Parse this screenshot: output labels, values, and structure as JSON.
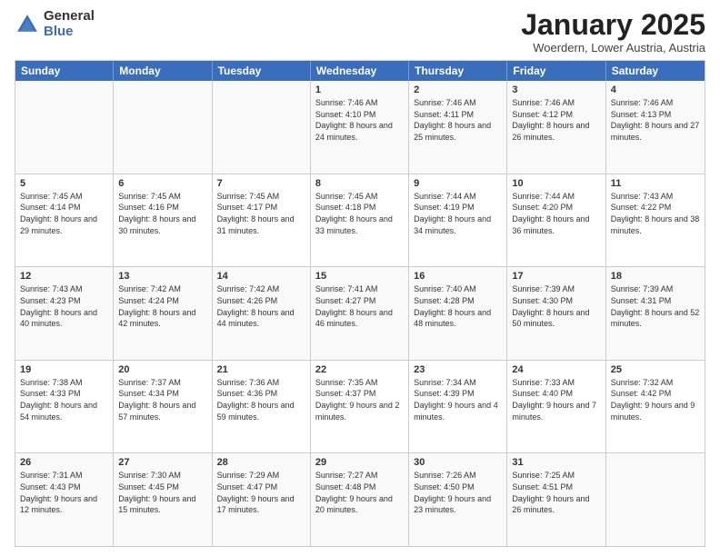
{
  "logo": {
    "general": "General",
    "blue": "Blue"
  },
  "title": "January 2025",
  "subtitle": "Woerdern, Lower Austria, Austria",
  "days_of_week": [
    "Sunday",
    "Monday",
    "Tuesday",
    "Wednesday",
    "Thursday",
    "Friday",
    "Saturday"
  ],
  "weeks": [
    [
      {
        "day": "",
        "sunrise": "",
        "sunset": "",
        "daylight": ""
      },
      {
        "day": "",
        "sunrise": "",
        "sunset": "",
        "daylight": ""
      },
      {
        "day": "",
        "sunrise": "",
        "sunset": "",
        "daylight": ""
      },
      {
        "day": "1",
        "sunrise": "Sunrise: 7:46 AM",
        "sunset": "Sunset: 4:10 PM",
        "daylight": "Daylight: 8 hours and 24 minutes."
      },
      {
        "day": "2",
        "sunrise": "Sunrise: 7:46 AM",
        "sunset": "Sunset: 4:11 PM",
        "daylight": "Daylight: 8 hours and 25 minutes."
      },
      {
        "day": "3",
        "sunrise": "Sunrise: 7:46 AM",
        "sunset": "Sunset: 4:12 PM",
        "daylight": "Daylight: 8 hours and 26 minutes."
      },
      {
        "day": "4",
        "sunrise": "Sunrise: 7:46 AM",
        "sunset": "Sunset: 4:13 PM",
        "daylight": "Daylight: 8 hours and 27 minutes."
      }
    ],
    [
      {
        "day": "5",
        "sunrise": "Sunrise: 7:45 AM",
        "sunset": "Sunset: 4:14 PM",
        "daylight": "Daylight: 8 hours and 29 minutes."
      },
      {
        "day": "6",
        "sunrise": "Sunrise: 7:45 AM",
        "sunset": "Sunset: 4:16 PM",
        "daylight": "Daylight: 8 hours and 30 minutes."
      },
      {
        "day": "7",
        "sunrise": "Sunrise: 7:45 AM",
        "sunset": "Sunset: 4:17 PM",
        "daylight": "Daylight: 8 hours and 31 minutes."
      },
      {
        "day": "8",
        "sunrise": "Sunrise: 7:45 AM",
        "sunset": "Sunset: 4:18 PM",
        "daylight": "Daylight: 8 hours and 33 minutes."
      },
      {
        "day": "9",
        "sunrise": "Sunrise: 7:44 AM",
        "sunset": "Sunset: 4:19 PM",
        "daylight": "Daylight: 8 hours and 34 minutes."
      },
      {
        "day": "10",
        "sunrise": "Sunrise: 7:44 AM",
        "sunset": "Sunset: 4:20 PM",
        "daylight": "Daylight: 8 hours and 36 minutes."
      },
      {
        "day": "11",
        "sunrise": "Sunrise: 7:43 AM",
        "sunset": "Sunset: 4:22 PM",
        "daylight": "Daylight: 8 hours and 38 minutes."
      }
    ],
    [
      {
        "day": "12",
        "sunrise": "Sunrise: 7:43 AM",
        "sunset": "Sunset: 4:23 PM",
        "daylight": "Daylight: 8 hours and 40 minutes."
      },
      {
        "day": "13",
        "sunrise": "Sunrise: 7:42 AM",
        "sunset": "Sunset: 4:24 PM",
        "daylight": "Daylight: 8 hours and 42 minutes."
      },
      {
        "day": "14",
        "sunrise": "Sunrise: 7:42 AM",
        "sunset": "Sunset: 4:26 PM",
        "daylight": "Daylight: 8 hours and 44 minutes."
      },
      {
        "day": "15",
        "sunrise": "Sunrise: 7:41 AM",
        "sunset": "Sunset: 4:27 PM",
        "daylight": "Daylight: 8 hours and 46 minutes."
      },
      {
        "day": "16",
        "sunrise": "Sunrise: 7:40 AM",
        "sunset": "Sunset: 4:28 PM",
        "daylight": "Daylight: 8 hours and 48 minutes."
      },
      {
        "day": "17",
        "sunrise": "Sunrise: 7:39 AM",
        "sunset": "Sunset: 4:30 PM",
        "daylight": "Daylight: 8 hours and 50 minutes."
      },
      {
        "day": "18",
        "sunrise": "Sunrise: 7:39 AM",
        "sunset": "Sunset: 4:31 PM",
        "daylight": "Daylight: 8 hours and 52 minutes."
      }
    ],
    [
      {
        "day": "19",
        "sunrise": "Sunrise: 7:38 AM",
        "sunset": "Sunset: 4:33 PM",
        "daylight": "Daylight: 8 hours and 54 minutes."
      },
      {
        "day": "20",
        "sunrise": "Sunrise: 7:37 AM",
        "sunset": "Sunset: 4:34 PM",
        "daylight": "Daylight: 8 hours and 57 minutes."
      },
      {
        "day": "21",
        "sunrise": "Sunrise: 7:36 AM",
        "sunset": "Sunset: 4:36 PM",
        "daylight": "Daylight: 8 hours and 59 minutes."
      },
      {
        "day": "22",
        "sunrise": "Sunrise: 7:35 AM",
        "sunset": "Sunset: 4:37 PM",
        "daylight": "Daylight: 9 hours and 2 minutes."
      },
      {
        "day": "23",
        "sunrise": "Sunrise: 7:34 AM",
        "sunset": "Sunset: 4:39 PM",
        "daylight": "Daylight: 9 hours and 4 minutes."
      },
      {
        "day": "24",
        "sunrise": "Sunrise: 7:33 AM",
        "sunset": "Sunset: 4:40 PM",
        "daylight": "Daylight: 9 hours and 7 minutes."
      },
      {
        "day": "25",
        "sunrise": "Sunrise: 7:32 AM",
        "sunset": "Sunset: 4:42 PM",
        "daylight": "Daylight: 9 hours and 9 minutes."
      }
    ],
    [
      {
        "day": "26",
        "sunrise": "Sunrise: 7:31 AM",
        "sunset": "Sunset: 4:43 PM",
        "daylight": "Daylight: 9 hours and 12 minutes."
      },
      {
        "day": "27",
        "sunrise": "Sunrise: 7:30 AM",
        "sunset": "Sunset: 4:45 PM",
        "daylight": "Daylight: 9 hours and 15 minutes."
      },
      {
        "day": "28",
        "sunrise": "Sunrise: 7:29 AM",
        "sunset": "Sunset: 4:47 PM",
        "daylight": "Daylight: 9 hours and 17 minutes."
      },
      {
        "day": "29",
        "sunrise": "Sunrise: 7:27 AM",
        "sunset": "Sunset: 4:48 PM",
        "daylight": "Daylight: 9 hours and 20 minutes."
      },
      {
        "day": "30",
        "sunrise": "Sunrise: 7:26 AM",
        "sunset": "Sunset: 4:50 PM",
        "daylight": "Daylight: 9 hours and 23 minutes."
      },
      {
        "day": "31",
        "sunrise": "Sunrise: 7:25 AM",
        "sunset": "Sunset: 4:51 PM",
        "daylight": "Daylight: 9 hours and 26 minutes."
      },
      {
        "day": "",
        "sunrise": "",
        "sunset": "",
        "daylight": ""
      }
    ]
  ]
}
